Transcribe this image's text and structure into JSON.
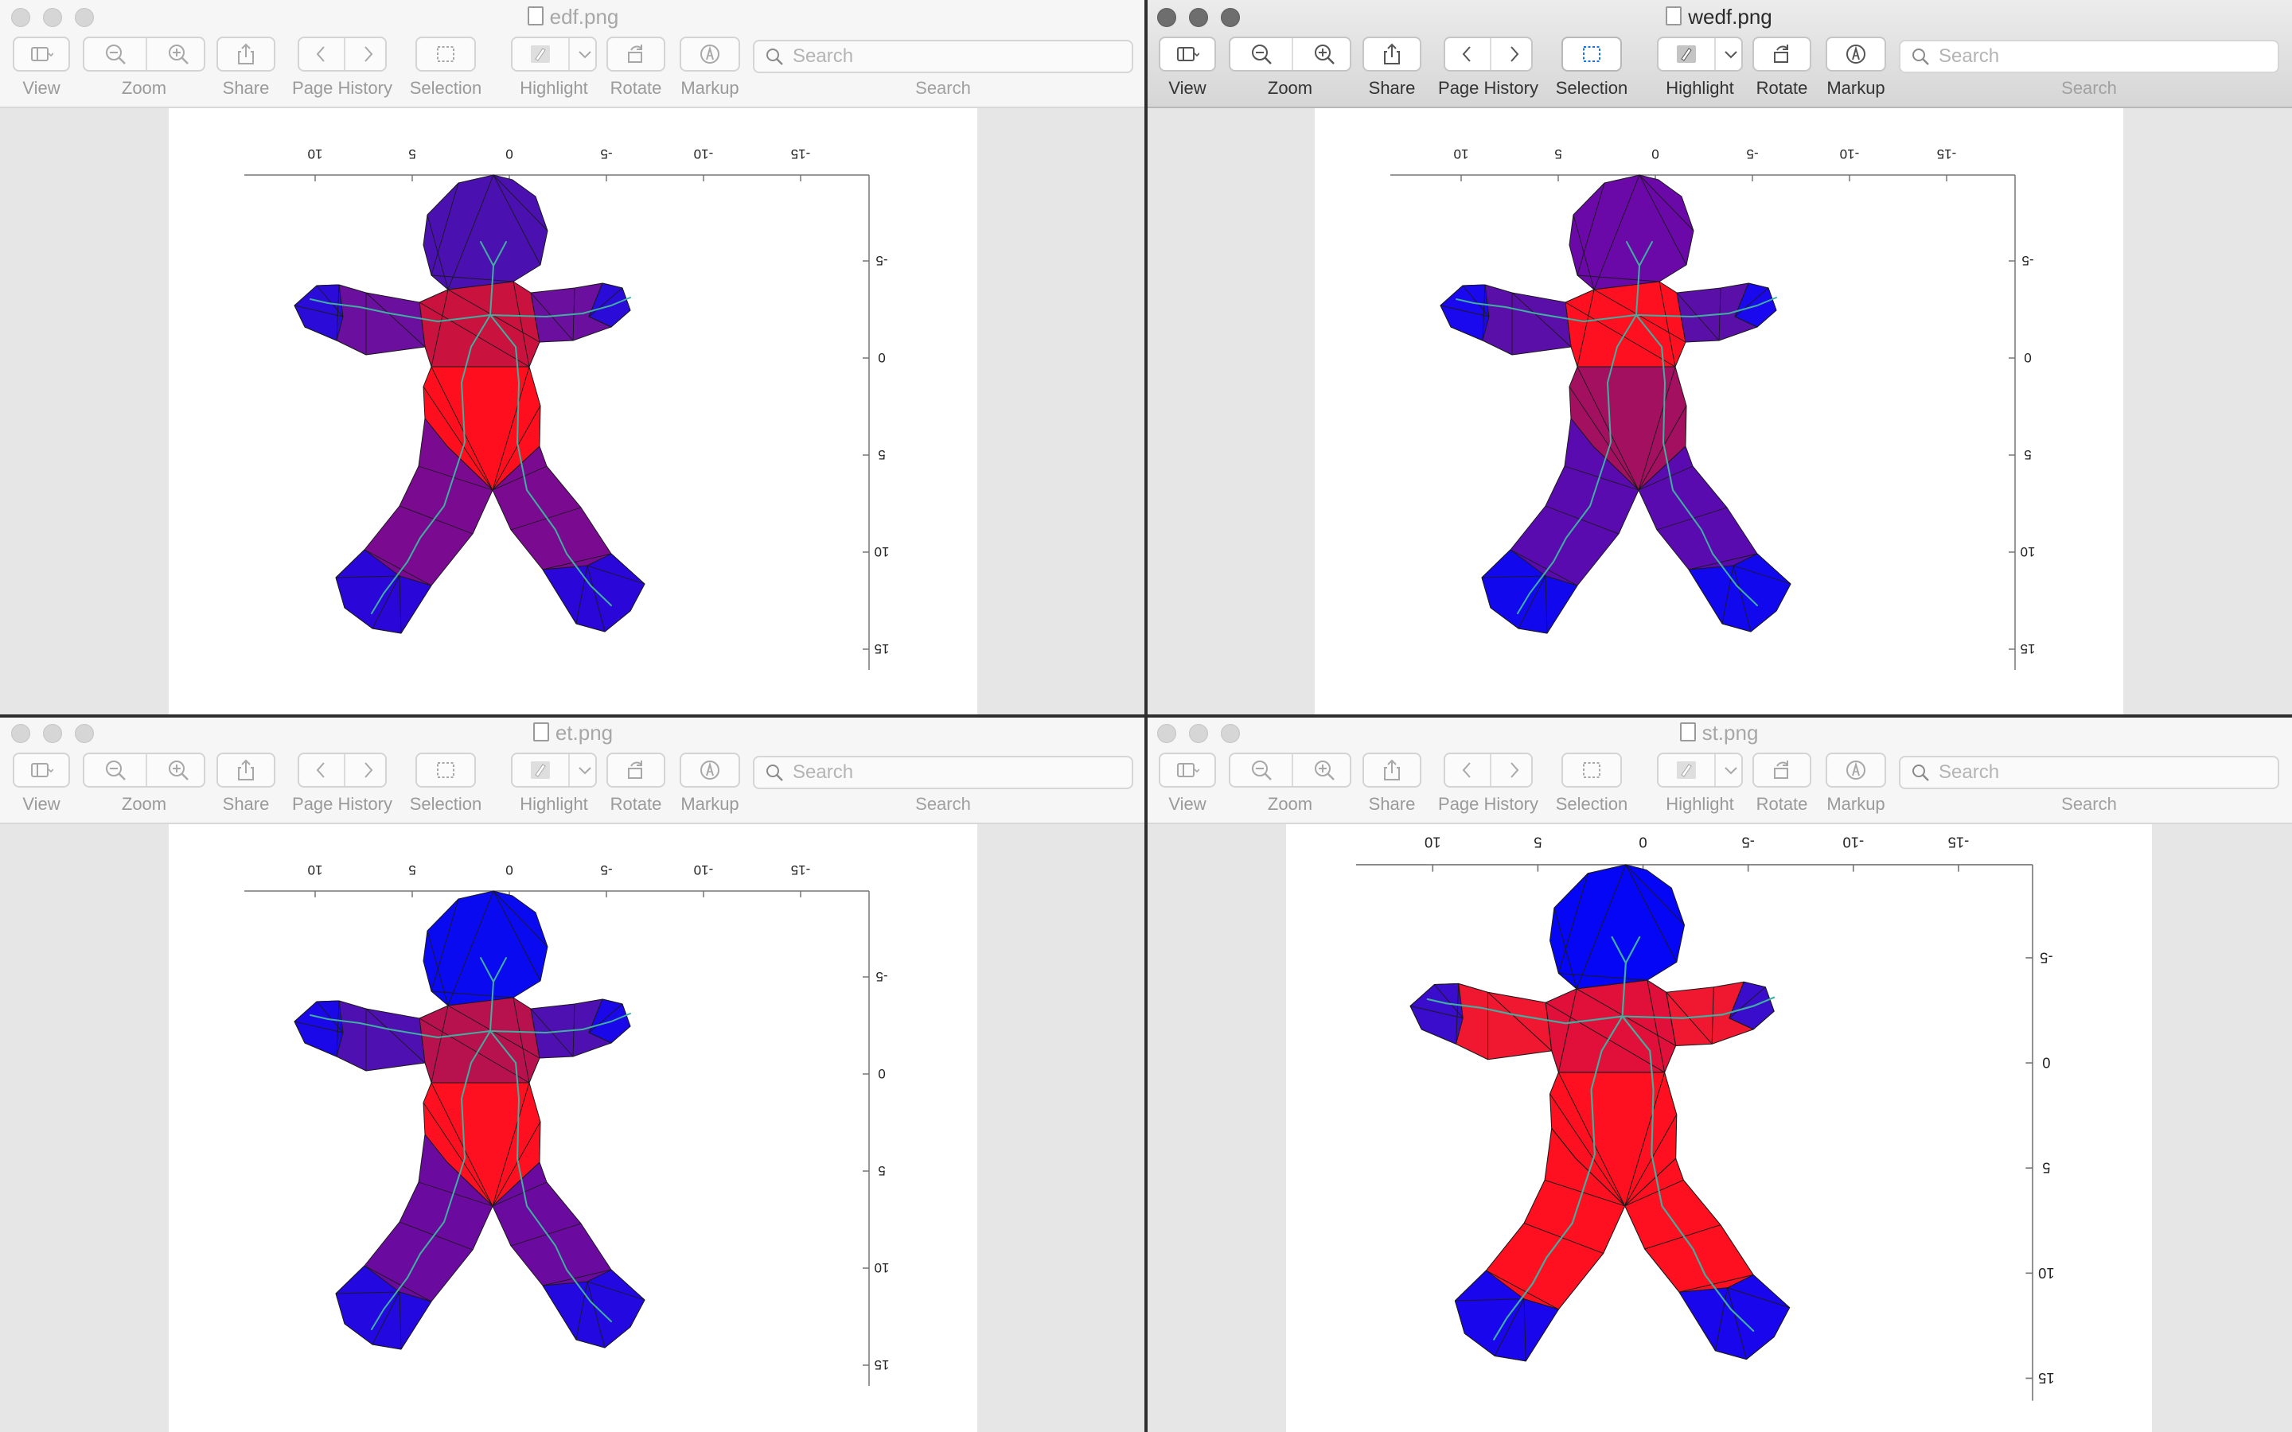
{
  "toolbar": {
    "view_label": "View",
    "zoom_label": "Zoom",
    "share_label": "Share",
    "page_history_label": "Page History",
    "selection_label": "Selection",
    "highlight_label": "Highlight",
    "rotate_label": "Rotate",
    "markup_label": "Markup",
    "search_placeholder": "Search",
    "search_label": "Search"
  },
  "windows": [
    {
      "title": "edf.png",
      "active": false,
      "chart_data": {
        "type": "mesh",
        "x_ticks": [
          "10",
          "5",
          "0",
          "-5",
          "-10",
          "-15"
        ],
        "y_ticks": [
          "-5",
          "0",
          "5",
          "10",
          "15"
        ],
        "colors": {
          "head": "#4a10b0",
          "torso_upper": "#c9123e",
          "torso_lower": "#ff0f1e",
          "arm_upper": "#6a0f9e",
          "hand": "#2a0bd8",
          "leg_upper": "#7a0a90",
          "foot": "#2a06d8"
        }
      }
    },
    {
      "title": "wedf.png",
      "active": true,
      "chart_data": {
        "type": "mesh",
        "x_ticks": [
          "10",
          "5",
          "0",
          "-5",
          "-10",
          "-15"
        ],
        "y_ticks": [
          "-5",
          "0",
          "5",
          "10",
          "15"
        ],
        "colors": {
          "head": "#6a08a8",
          "torso_upper": "#ff1020",
          "torso_lower": "#a41060",
          "arm_upper": "#5a10a8",
          "hand": "#1a08ee",
          "leg_upper": "#5a0bb0",
          "foot": "#1208ee"
        }
      }
    },
    {
      "title": "et.png",
      "active": false,
      "chart_data": {
        "type": "mesh",
        "x_ticks": [
          "10",
          "5",
          "0",
          "-5",
          "-10",
          "-15"
        ],
        "y_ticks": [
          "-5",
          "0",
          "5",
          "10",
          "15"
        ],
        "colors": {
          "head": "#0a0af0",
          "torso_upper": "#b8124e",
          "torso_lower": "#ff1020",
          "arm_upper": "#4f10b2",
          "hand": "#1a08e8",
          "leg_upper": "#6a0a9e",
          "foot": "#2408e0"
        }
      }
    },
    {
      "title": "st.png",
      "active": false,
      "chart_data": {
        "type": "mesh",
        "x_ticks": [
          "10",
          "5",
          "0",
          "-5",
          "-10",
          "-15"
        ],
        "y_ticks": [
          "-5",
          "0",
          "5",
          "10",
          "15"
        ],
        "colors": {
          "head": "#0606f6",
          "torso_upper": "#e0103a",
          "torso_lower": "#ff1020",
          "arm_upper": "#f01830",
          "hand": "#3a0ccc",
          "leg_upper": "#ff1020",
          "foot": "#1a06ec"
        }
      }
    }
  ]
}
